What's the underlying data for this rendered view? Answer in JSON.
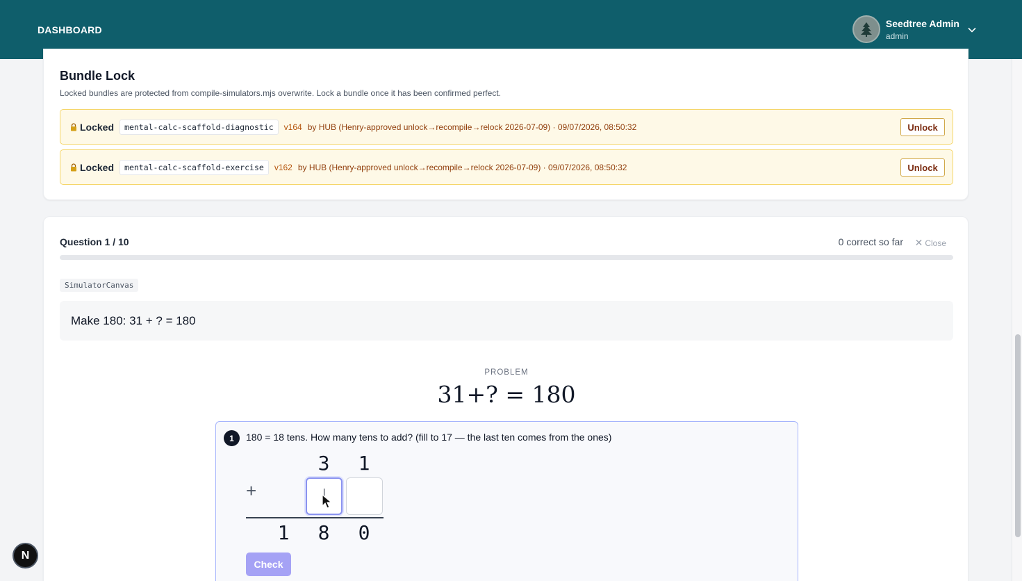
{
  "header": {
    "title": "DASHBOARD",
    "user": {
      "name": "Seedtree Admin",
      "role": "admin"
    }
  },
  "bundle_lock": {
    "title": "Bundle Lock",
    "description": "Locked bundles are protected from compile-simulators.mjs overwrite. Lock a bundle once it has been confirmed perfect.",
    "rows": [
      {
        "status": "Locked",
        "bundle": "mental-calc-scaffold-diagnostic",
        "version": "v164",
        "byline": "by HUB (Henry-approved unlock→recompile→relock 2026-07-09) · 09/07/2026, 08:50:32",
        "action": "Unlock"
      },
      {
        "status": "Locked",
        "bundle": "mental-calc-scaffold-exercise",
        "version": "v162",
        "byline": "by HUB (Henry-approved unlock→recompile→relock 2026-07-09) · 09/07/2026, 08:50:32",
        "action": "Unlock"
      }
    ]
  },
  "quiz": {
    "counter": "Question 1 / 10",
    "correct": "0 correct so far",
    "close_label": "Close",
    "progress": 0.0,
    "component_tag": "SimulatorCanvas",
    "prompt": "Make 180: 31 + ? = 180",
    "problem_label": "PROBLEM",
    "equation": "31+? = 180",
    "step": {
      "number": "1",
      "instruction": "180 = 18 tens. How many tens to add? (fill to 17 — the last ten comes from the ones)",
      "top_digits": [
        "3",
        "1"
      ],
      "operator": "+",
      "answer_tens_value": "",
      "answer_ones_value": "",
      "result_digits": [
        "1",
        "8",
        "0"
      ],
      "check_label": "Check"
    }
  },
  "dev_badge": "N",
  "colors": {
    "header_bg": "#0f5e6b",
    "lock_row_bg": "#fef9e7",
    "lock_row_border": "#f5d66a",
    "accent": "#6366f1",
    "check_button": "#a5a2f5"
  }
}
